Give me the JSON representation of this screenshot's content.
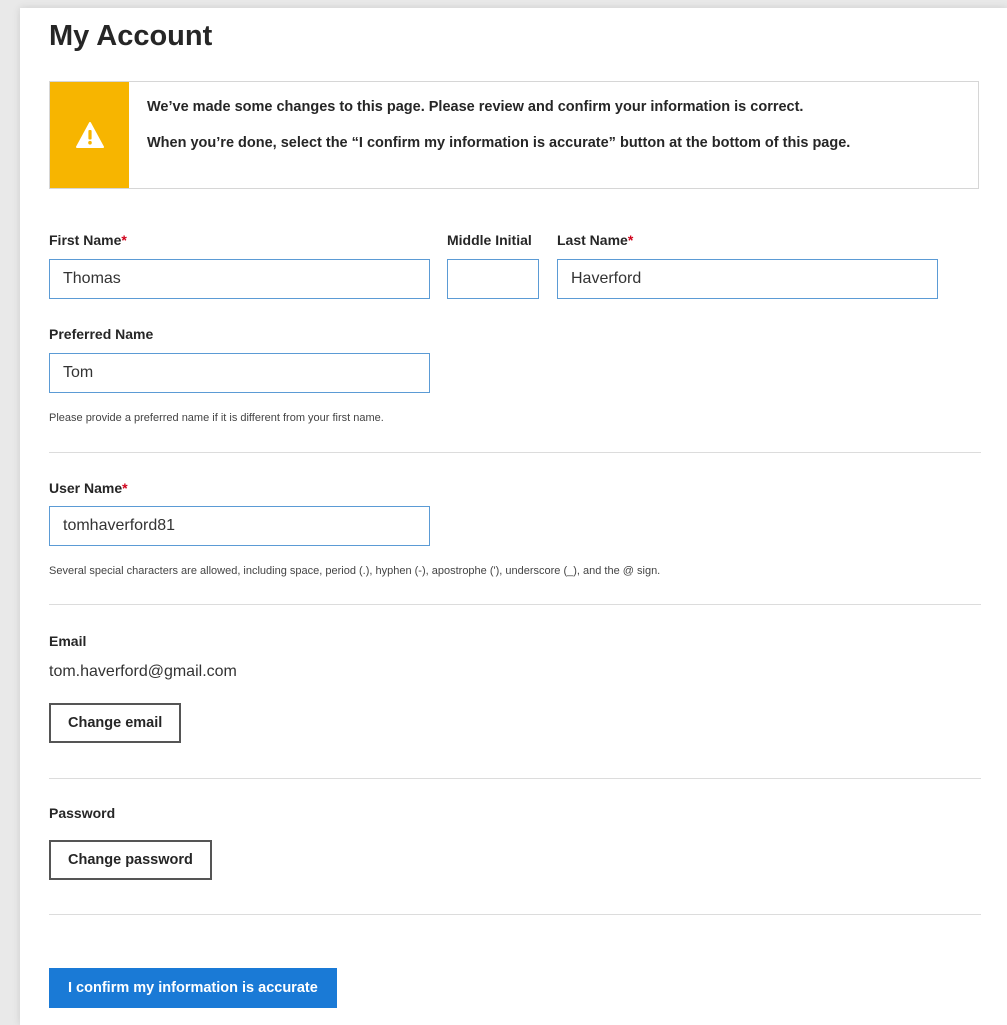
{
  "page": {
    "title": "My Account"
  },
  "alert": {
    "icon": "warning-icon",
    "accent_color": "#f7b500",
    "line1": "We’ve made some changes to this page. Please review and confirm your information is correct.",
    "line2": "When you’re done, select the “I confirm my information is accurate” button at the bottom of this page."
  },
  "form": {
    "required_marker": "*",
    "required_color": "#d0021b",
    "first_name": {
      "label": "First Name",
      "value": "Thomas"
    },
    "middle_initial": {
      "label": "Middle Initial",
      "value": ""
    },
    "last_name": {
      "label": "Last Name",
      "value": "Haverford"
    },
    "preferred_name": {
      "label": "Preferred Name",
      "value": "Tom",
      "hint": "Please provide a preferred name if it is different from your first name."
    },
    "user_name": {
      "label": "User Name",
      "value": "tomhaverford81",
      "hint": "Several special characters are allowed, including space, period (.), hyphen (-), apostrophe ('), underscore (_), and the @ sign."
    },
    "email": {
      "label": "Email",
      "value": "tom.haverford@gmail.com",
      "button_label": "Change email"
    },
    "password": {
      "label": "Password",
      "button_label": "Change password"
    },
    "confirm_button": {
      "label": "I confirm my information is accurate",
      "color": "#1a7ad6"
    }
  }
}
